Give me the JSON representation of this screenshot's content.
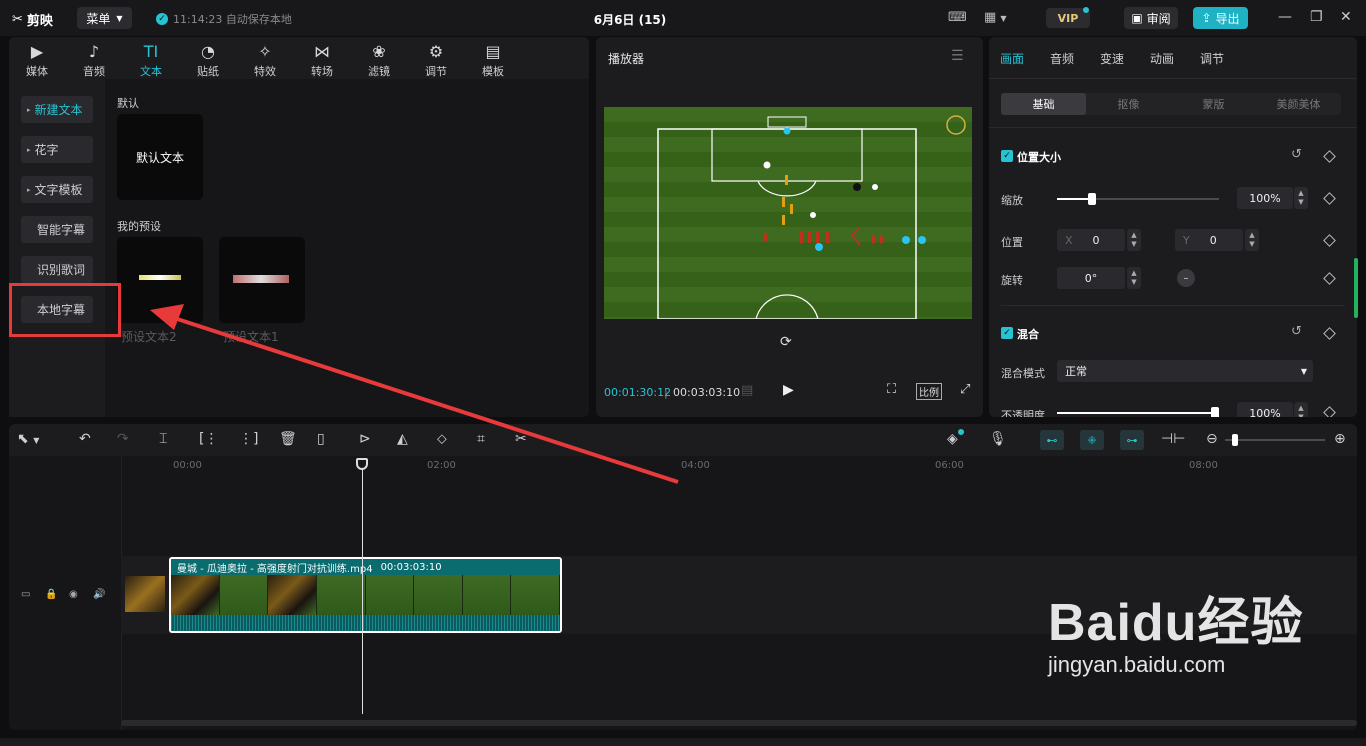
{
  "app": {
    "name": "剪映",
    "menu_label": "菜单",
    "autosave": "11:14:23 自动保存本地",
    "project_title": "6月6日 (15)",
    "vip_label": "VIP",
    "review_label": "审阅",
    "export_label": "导出"
  },
  "media_categories": [
    {
      "label": "媒体",
      "icon": "media-icon"
    },
    {
      "label": "音频",
      "icon": "audio-icon"
    },
    {
      "label": "文本",
      "icon": "text-icon",
      "active": true
    },
    {
      "label": "贴纸",
      "icon": "sticker-icon"
    },
    {
      "label": "特效",
      "icon": "effects-icon"
    },
    {
      "label": "转场",
      "icon": "transition-icon"
    },
    {
      "label": "滤镜",
      "icon": "filter-icon"
    },
    {
      "label": "调节",
      "icon": "adjust-icon"
    },
    {
      "label": "模板",
      "icon": "template-icon"
    }
  ],
  "text_sidebar": [
    "新建文本",
    "花字",
    "文字模板",
    "智能字幕",
    "识别歌词",
    "本地字幕"
  ],
  "text_section": {
    "default_title": "默认",
    "default_tile": "默认文本",
    "presets_title": "我的预设",
    "preset_1": "预设文本2",
    "preset_2": "预设文本1"
  },
  "player": {
    "title": "播放器",
    "current_time": "00:01:30:12",
    "total_time": "00:03:03:10",
    "ratio_label": "比例"
  },
  "inspector": {
    "tabs": [
      "画面",
      "音频",
      "变速",
      "动画",
      "调节"
    ],
    "subtabs": [
      "基础",
      "抠像",
      "蒙版",
      "美颜美体"
    ],
    "position_size": "位置大小",
    "scale_label": "缩放",
    "scale_value": "100%",
    "position_label": "位置",
    "x_label": "X",
    "x_value": "0",
    "y_label": "Y",
    "y_value": "0",
    "rotate_label": "旋转",
    "rotate_value": "0°",
    "blend": "混合",
    "blend_mode_label": "混合模式",
    "blend_mode_value": "正常",
    "opacity_label": "不透明度",
    "opacity_value": "100%"
  },
  "timeline": {
    "ruler": [
      "00:00",
      "02:00",
      "04:00",
      "06:00",
      "08:00"
    ],
    "clip_name": "曼城 - 瓜迪奥拉 - 高强度射门对抗训练.mp4",
    "clip_duration": "00:03:03:10"
  },
  "watermark": {
    "brand": "Baidu经验",
    "url": "jingyan.baidu.com"
  },
  "colors": {
    "accent": "#27c3d3",
    "highlight": "#e83a3a",
    "export": "#1fb1c4"
  }
}
